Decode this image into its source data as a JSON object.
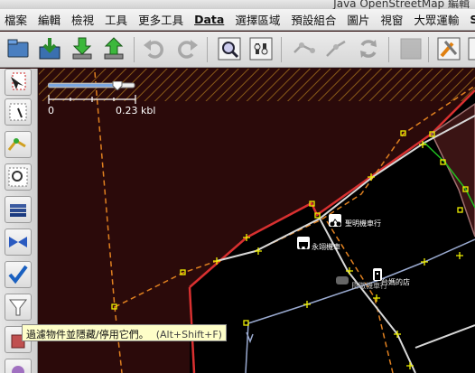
{
  "window": {
    "title": "Java OpenStreetMap 編輯"
  },
  "menu": [
    {
      "label": "檔案"
    },
    {
      "label": "編輯"
    },
    {
      "label": "檢視"
    },
    {
      "label": "工具"
    },
    {
      "label": "更多工具"
    },
    {
      "label": "Data"
    },
    {
      "label": "選擇區域"
    },
    {
      "label": "預設組合"
    },
    {
      "label": "圖片"
    },
    {
      "label": "視窗"
    },
    {
      "label": "大眾運輸"
    },
    {
      "label": "Scri"
    }
  ],
  "toolbar": {
    "icons": [
      "open-icon",
      "download-icon",
      "download-green-icon",
      "upload-icon",
      "undo-icon",
      "redo-icon",
      "zoom-icon",
      "preferences-icon",
      "merge-nodes-icon",
      "split-way-icon",
      "refresh-icon",
      "image-icon",
      "tools-icon"
    ]
  },
  "sidebar": {
    "icons": [
      "select-icon",
      "lasso-icon",
      "draw-icon",
      "zoom-area-icon",
      "layers-icon",
      "move-icon",
      "validate-icon",
      "filter-icon",
      "delete-icon"
    ]
  },
  "map": {
    "scale": {
      "zero": "0",
      "distance": "0.23 kbl"
    },
    "zoom_slider_level": 0.8,
    "pois": [
      {
        "label": "聖明機車行"
      },
      {
        "label": "永翊機車"
      },
      {
        "label": "台媽的店"
      },
      {
        "label": "臣嗷機車行"
      }
    ]
  },
  "tooltip": {
    "text": "過濾物件並隱藏/停用它們。",
    "shortcut": "(Alt+Shift+F)"
  },
  "colors": {
    "map_background": "#2b0a0a",
    "inside_area": "#000000",
    "border_red": "#d83030",
    "dashed_orange": "#e08020",
    "way_white": "#d8d8d8",
    "node_yellow": "#f0f000",
    "green_way": "#20c020",
    "tooltip_bg": "#fefec8"
  }
}
